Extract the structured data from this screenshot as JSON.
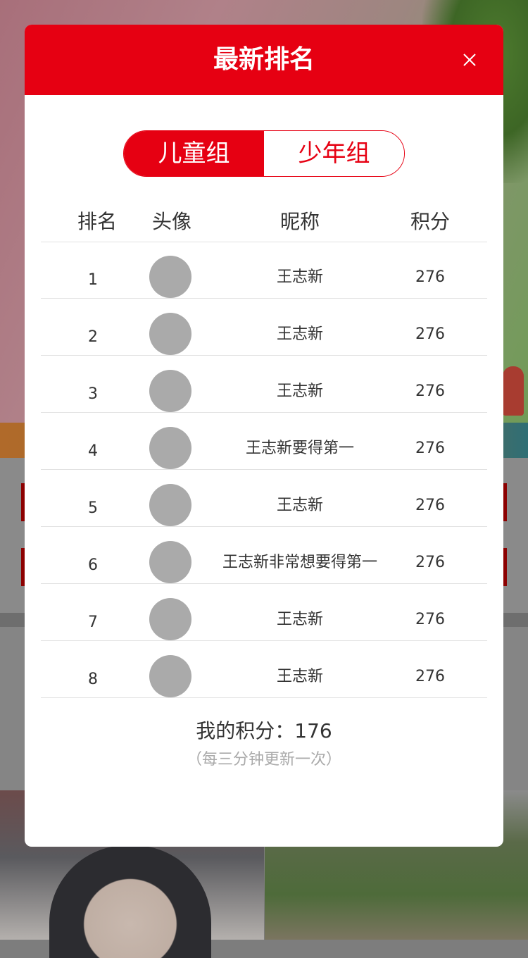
{
  "modal": {
    "title": "最新排名",
    "close_icon": "close-icon"
  },
  "tabs": [
    {
      "label": "儿童组",
      "active": true
    },
    {
      "label": "少年组",
      "active": false
    }
  ],
  "table": {
    "headers": {
      "rank": "排名",
      "avatar": "头像",
      "nickname": "昵称",
      "score": "积分"
    },
    "rows": [
      {
        "rank": "1",
        "nickname": "王志新",
        "score": "276"
      },
      {
        "rank": "2",
        "nickname": "王志新",
        "score": "276"
      },
      {
        "rank": "3",
        "nickname": "王志新",
        "score": "276"
      },
      {
        "rank": "4",
        "nickname": "王志新要得第一",
        "score": "276"
      },
      {
        "rank": "5",
        "nickname": "王志新",
        "score": "276"
      },
      {
        "rank": "6",
        "nickname": "王志新非常想要得第一",
        "score": "276"
      },
      {
        "rank": "7",
        "nickname": "王志新",
        "score": "276"
      },
      {
        "rank": "8",
        "nickname": "王志新",
        "score": "276"
      }
    ]
  },
  "footer": {
    "my_score": "我的积分：176",
    "note": "（每三分钟更新一次）"
  },
  "colors": {
    "accent": "#e60012",
    "avatar_placeholder": "#aaaaaa"
  }
}
